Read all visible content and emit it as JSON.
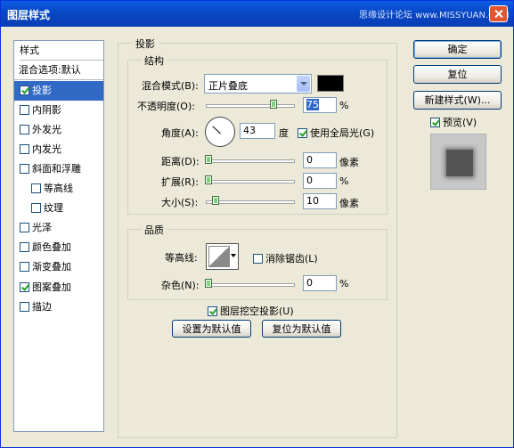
{
  "window": {
    "title": "图层样式",
    "watermark": "思缘设计论坛 www.MISSYUAN.COM"
  },
  "sidebar": {
    "header": "样式",
    "blend_options": "混合选项:默认",
    "items": [
      {
        "label": "投影",
        "checked": true
      },
      {
        "label": "内阴影",
        "checked": false
      },
      {
        "label": "外发光",
        "checked": false
      },
      {
        "label": "内发光",
        "checked": false
      },
      {
        "label": "斜面和浮雕",
        "checked": false
      },
      {
        "label": "等高线",
        "checked": false
      },
      {
        "label": "纹理",
        "checked": false
      },
      {
        "label": "光泽",
        "checked": false
      },
      {
        "label": "颜色叠加",
        "checked": false
      },
      {
        "label": "渐变叠加",
        "checked": false
      },
      {
        "label": "图案叠加",
        "checked": true
      },
      {
        "label": "描边",
        "checked": false
      }
    ]
  },
  "drop_shadow": {
    "title": "投影",
    "structure": {
      "title": "结构",
      "blend_mode_label": "混合模式(B):",
      "blend_mode_value": "正片叠底",
      "shadow_color": "#000000",
      "opacity_label": "不透明度(O):",
      "opacity_value": "75",
      "opacity_unit": "%",
      "angle_label": "角度(A):",
      "angle_value": "43",
      "angle_unit": "度",
      "global_light_label": "使用全局光(G)",
      "distance_label": "距离(D):",
      "distance_value": "0",
      "distance_unit": "像素",
      "spread_label": "扩展(R):",
      "spread_value": "0",
      "spread_unit": "%",
      "size_label": "大小(S):",
      "size_value": "10",
      "size_unit": "像素"
    },
    "quality": {
      "title": "品质",
      "contour_label": "等高线:",
      "anti_alias_label": "消除锯齿(L)",
      "noise_label": "杂色(N):",
      "noise_value": "0",
      "noise_unit": "%"
    },
    "knockout_label": "图层挖空投影(U)",
    "make_default": "设置为默认值",
    "reset_default": "复位为默认值"
  },
  "actions": {
    "ok": "确定",
    "reset": "复位",
    "new_style": "新建样式(W)...",
    "preview_label": "预览(V)"
  }
}
